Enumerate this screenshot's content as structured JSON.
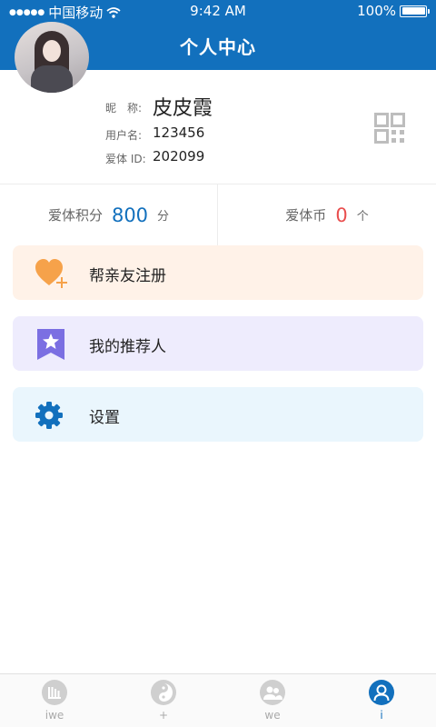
{
  "status_bar": {
    "signal_dots": "●●●●●",
    "carrier": "中国移动",
    "time": "9:42 AM",
    "battery": "100%"
  },
  "header": {
    "title": "个人中心"
  },
  "profile": {
    "nickname_label": "昵　称:",
    "nickname": "皮皮霞",
    "username_label": "用户名:",
    "username": "123456",
    "id_label": "爱体 ID:",
    "id": "202099"
  },
  "stats": {
    "points_label": "爱体积分",
    "points_value": "800",
    "points_unit": "分",
    "coins_label": "爱体币",
    "coins_value": "0",
    "coins_unit": "个"
  },
  "menu": [
    {
      "label": "帮亲友注册",
      "icon": "heart-plus-icon",
      "color": "#f6a24a"
    },
    {
      "label": "我的推荐人",
      "icon": "star-bookmark-icon",
      "color": "#7b6fe2"
    },
    {
      "label": "设置",
      "icon": "gear-icon",
      "color": "#1270bd"
    }
  ],
  "tabbar": [
    {
      "label": "iwe",
      "icon": "bars-icon"
    },
    {
      "label": "+",
      "icon": "yin-yang-icon"
    },
    {
      "label": "we",
      "icon": "people-icon"
    },
    {
      "label": "i",
      "icon": "person-icon",
      "active": true
    }
  ],
  "colors": {
    "primary": "#1270bd",
    "coin_red": "#e94e4e"
  }
}
